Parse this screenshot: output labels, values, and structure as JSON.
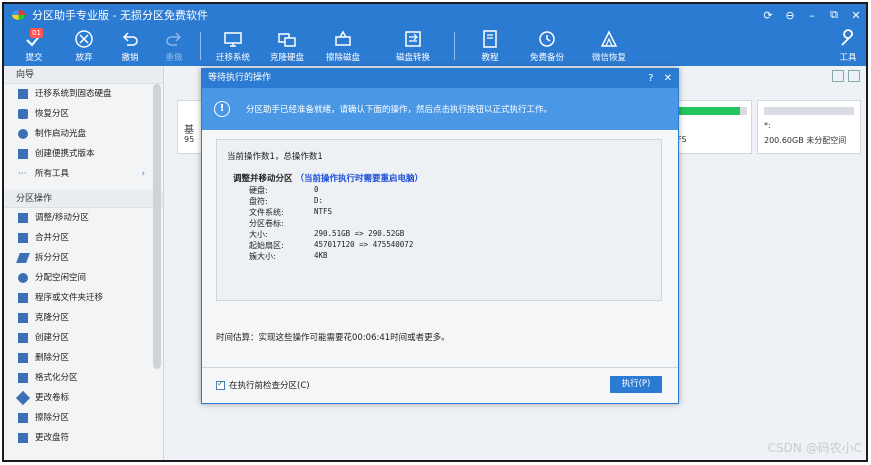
{
  "window": {
    "title": "分区助手专业版 - 无损分区免费软件",
    "controls": [
      "refresh-icon",
      "restore-icon",
      "minimize-icon",
      "maximize-icon",
      "close-icon"
    ]
  },
  "toolbar": {
    "commit": {
      "label": "提交",
      "badge": "01"
    },
    "discard": {
      "label": "放弃"
    },
    "undo": {
      "label": "撤销"
    },
    "redo": {
      "label": "重做"
    },
    "migrate_os": {
      "label": "迁移系统"
    },
    "clone_disk": {
      "label": "克隆硬盘"
    },
    "wipe_disk": {
      "label": "擦除磁盘"
    },
    "disk_convert": {
      "label": "磁盘转换"
    },
    "tutorial": {
      "label": "教程"
    },
    "free_backup": {
      "label": "免费备份"
    },
    "wechat_restore": {
      "label": "微信恢复"
    },
    "tools": {
      "label": "工具"
    }
  },
  "sidebar": {
    "wizard_heading": "向导",
    "wizard_items": [
      {
        "label": "迁移系统到固态硬盘"
      },
      {
        "label": "恢复分区"
      },
      {
        "label": "制作启动光盘"
      },
      {
        "label": "创建便携式版本"
      },
      {
        "label": "所有工具"
      }
    ],
    "ops_heading": "分区操作",
    "ops_items": [
      {
        "label": "调整/移动分区"
      },
      {
        "label": "合并分区"
      },
      {
        "label": "拆分分区"
      },
      {
        "label": "分配空闲空间"
      },
      {
        "label": "程序或文件夹迁移"
      },
      {
        "label": "克隆分区"
      },
      {
        "label": "创建分区"
      },
      {
        "label": "删除分区"
      },
      {
        "label": "格式化分区"
      },
      {
        "label": "更改卷标"
      },
      {
        "label": "擦除分区"
      },
      {
        "label": "更改盘符"
      }
    ]
  },
  "main": {
    "disk_partial_left": {
      "label": "基",
      "size_prefix": "95"
    },
    "disk_partial_mid": {
      "fs": "FS",
      "used_fraction": 0.9
    },
    "disk_unalloc": {
      "label": "*:",
      "detail": "200.60GB 未分配空间"
    }
  },
  "dialog": {
    "title": "等待执行的操作",
    "banner": "分区助手已经准备就绪，请确认下面的操作，然后点击执行按钮以正式执行工作。",
    "summary": "当前操作数1，总操作数1",
    "operation": {
      "title": "调整并移动分区",
      "note": "（当前操作执行时需要重启电脑）",
      "fields": [
        {
          "key": "硬盘:",
          "value": "0"
        },
        {
          "key": "盘符:",
          "value": "D:"
        },
        {
          "key": "文件系统:",
          "value": "NTFS"
        },
        {
          "key": "分区卷标:",
          "value": ""
        },
        {
          "key": "大小:",
          "value": "290.51GB => 290.52GB"
        },
        {
          "key": "起始扇区:",
          "value": "457017120 => 475540072"
        },
        {
          "key": "簇大小:",
          "value": "4KB"
        }
      ]
    },
    "time_estimate": "时间估算：实现这些操作可能需要花00:06:41时间或者更多。",
    "checkbox_label": "在执行前检查分区(C)",
    "execute_label": "执行(P)",
    "help_icon": "?",
    "close_icon": "✕"
  },
  "watermark": "CSDN @码农小C"
}
